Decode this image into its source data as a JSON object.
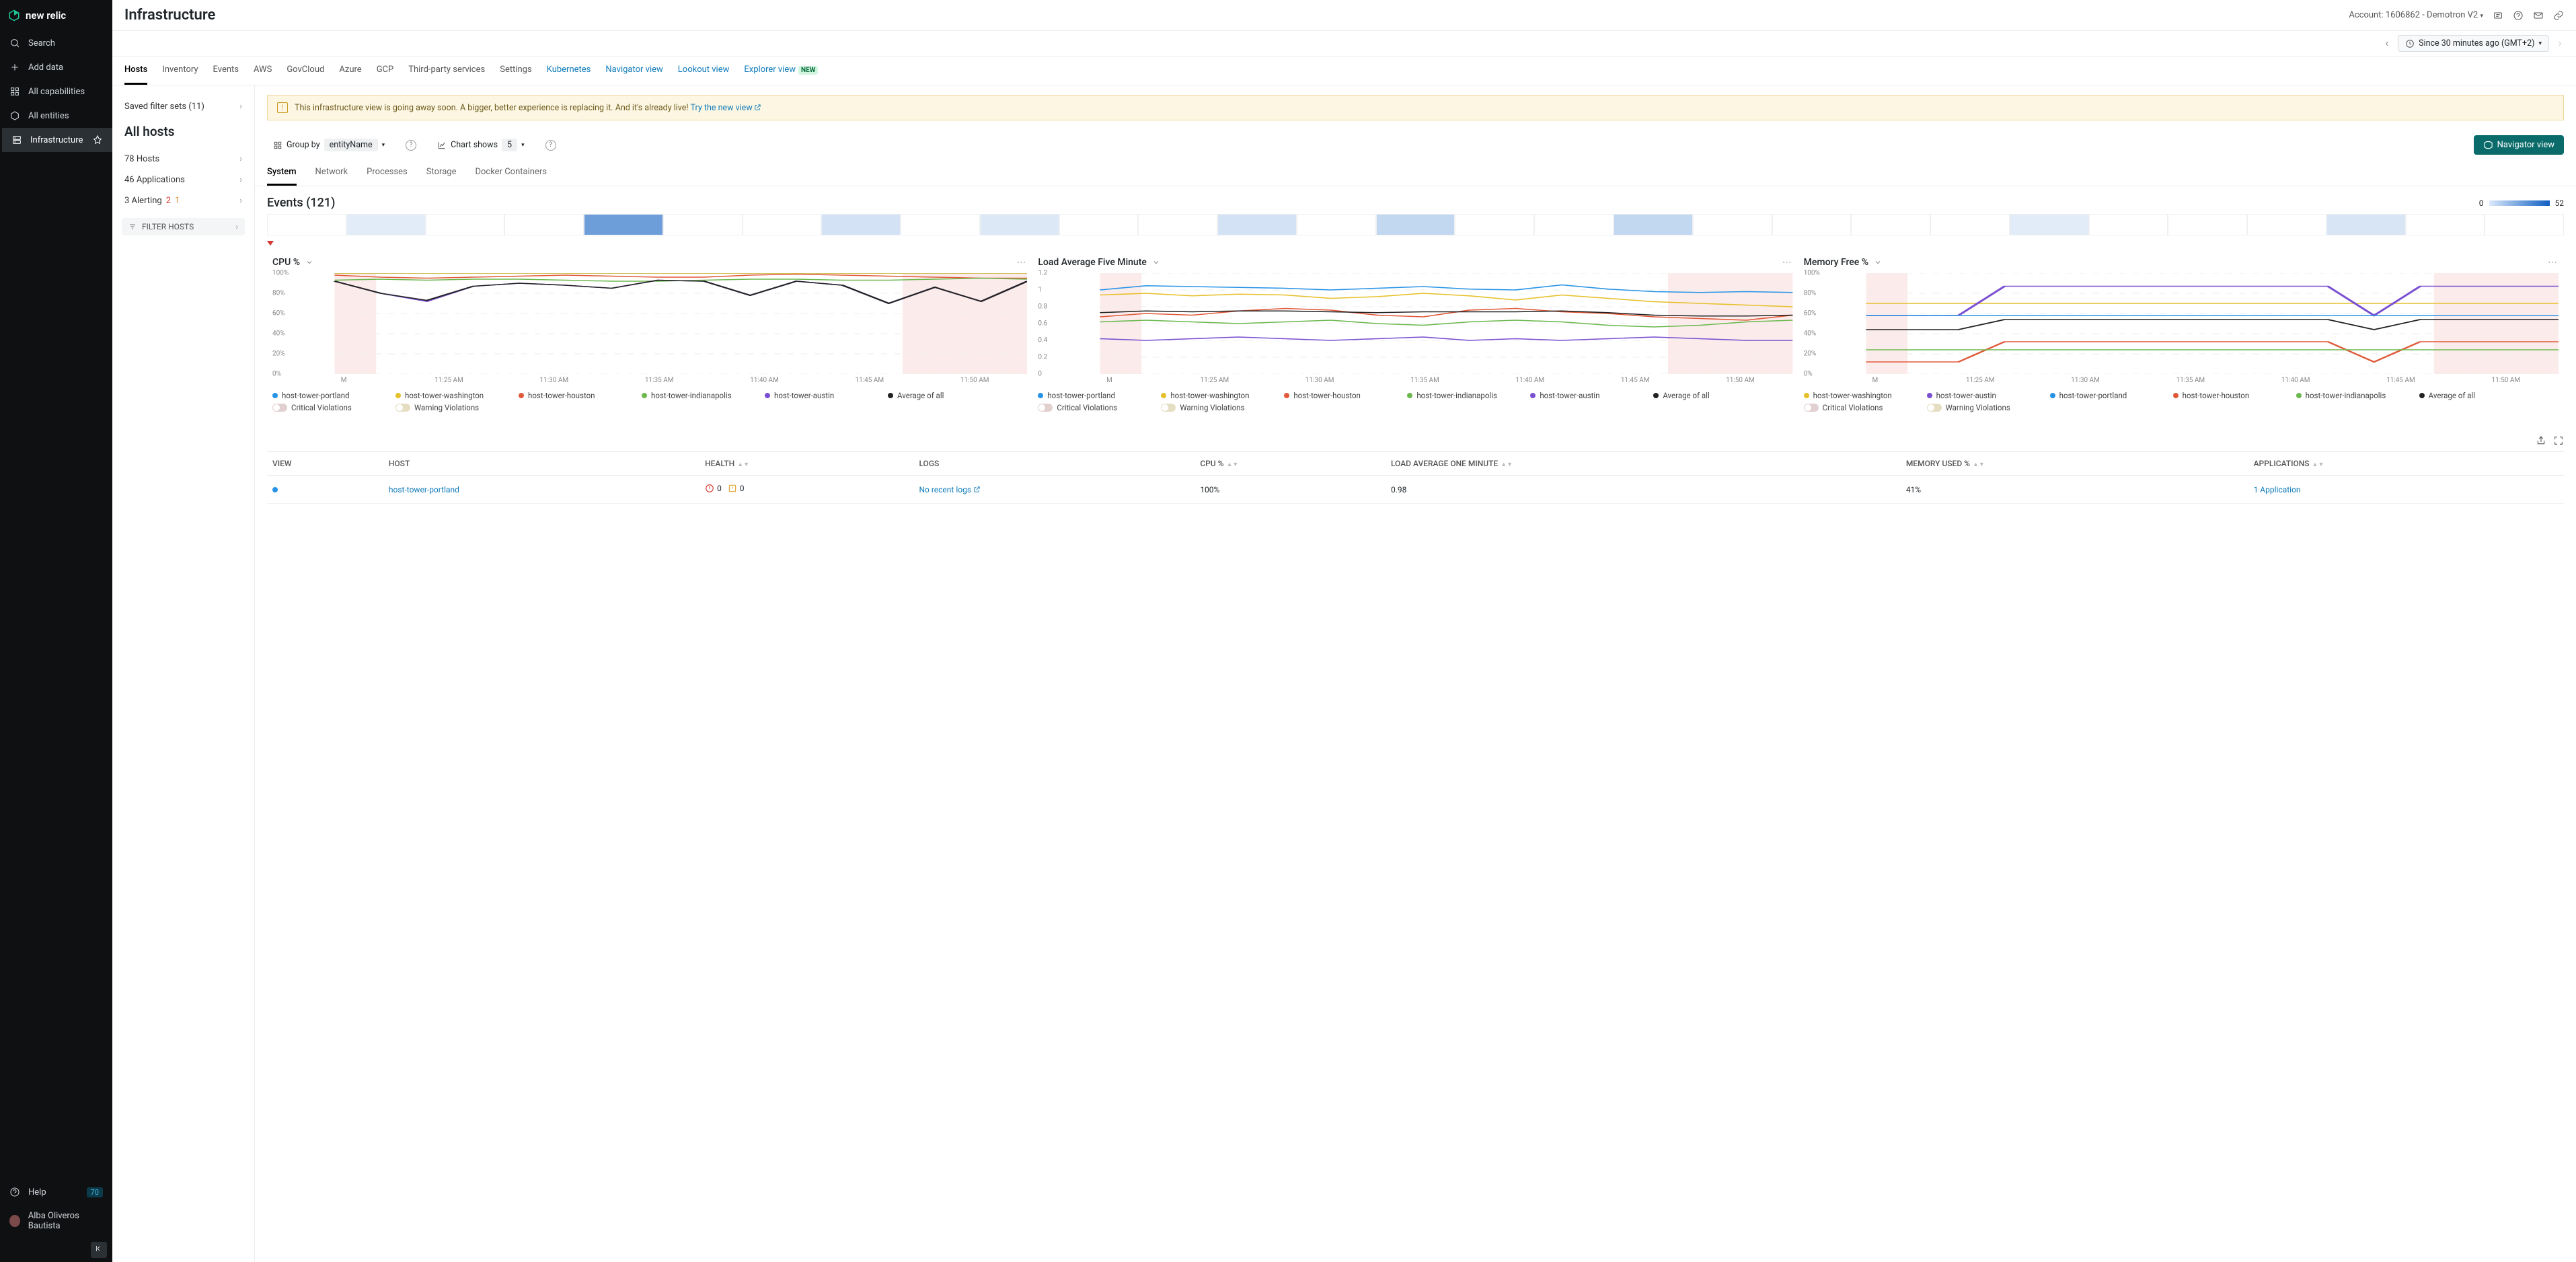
{
  "brand": "new relic",
  "page_title": "Infrastructure",
  "account_label": "Account: 1606862 - Demotron V2",
  "time_range": "Since 30 minutes ago (GMT+2)",
  "sidebar": {
    "items": [
      {
        "label": "Search",
        "icon": "search"
      },
      {
        "label": "Add data",
        "icon": "plus"
      },
      {
        "label": "All capabilities",
        "icon": "grid"
      },
      {
        "label": "All entities",
        "icon": "hex"
      },
      {
        "label": "Infrastructure",
        "icon": "server",
        "active": true
      }
    ],
    "help_label": "Help",
    "help_count": "70",
    "user_name": "Alba Oliveros Bautista"
  },
  "tabs": [
    {
      "label": "Hosts",
      "active": true
    },
    {
      "label": "Inventory"
    },
    {
      "label": "Events"
    },
    {
      "label": "AWS"
    },
    {
      "label": "GovCloud"
    },
    {
      "label": "Azure"
    },
    {
      "label": "GCP"
    },
    {
      "label": "Third-party services"
    },
    {
      "label": "Settings"
    },
    {
      "label": "Kubernetes",
      "link": true
    },
    {
      "label": "Navigator view",
      "link": true
    },
    {
      "label": "Lookout view",
      "link": true
    },
    {
      "label": "Explorer view",
      "link": true,
      "badge": "NEW"
    }
  ],
  "leftcol": {
    "saved_filters": "Saved filter sets (11)",
    "title": "All hosts",
    "rows": [
      {
        "label": "78 Hosts"
      },
      {
        "label": "46 Applications"
      },
      {
        "label": "3 Alerting",
        "red": "2",
        "orange": "1"
      }
    ],
    "filter_btn": "FILTER HOSTS"
  },
  "banner": {
    "text": "This infrastructure view is going away soon. A bigger, better experience is replacing it. And it's already live! ",
    "link": "Try the new view"
  },
  "tools": {
    "group_by_label": "Group by",
    "group_by_value": "entityName",
    "chart_shows_label": "Chart shows",
    "chart_shows_value": "5",
    "nav_view_btn": "Navigator view"
  },
  "subtabs": [
    "System",
    "Network",
    "Processes",
    "Storage",
    "Docker Containers"
  ],
  "events": {
    "title": "Events (121)",
    "scale_min": "0",
    "scale_max": "52"
  },
  "heatmap_opacity": [
    0,
    0.12,
    0,
    0,
    0.6,
    0,
    0,
    0.18,
    0,
    0.14,
    0,
    0,
    0.18,
    0,
    0.25,
    0,
    0,
    0.25,
    0,
    0,
    0,
    0,
    0.12,
    0,
    0,
    0,
    0.16,
    0,
    0
  ],
  "x_ticks": [
    "M",
    "11:25 AM",
    "11:30 AM",
    "11:35 AM",
    "11:40 AM",
    "11:45 AM",
    "11:50 AM"
  ],
  "legend_hosts": [
    {
      "name": "host-tower-portland",
      "color": "#2693e6"
    },
    {
      "name": "host-tower-washington",
      "color": "#e6c02a"
    },
    {
      "name": "host-tower-houston",
      "color": "#e05a3a"
    },
    {
      "name": "host-tower-indianapolis",
      "color": "#6cb84f"
    },
    {
      "name": "host-tower-austin",
      "color": "#7a4fd1"
    },
    {
      "name": "Average of all",
      "color": "#222"
    }
  ],
  "legend_hosts_mem": [
    {
      "name": "host-tower-washington",
      "color": "#e6c02a"
    },
    {
      "name": "host-tower-austin",
      "color": "#7a4fd1"
    },
    {
      "name": "host-tower-portland",
      "color": "#2693e6"
    },
    {
      "name": "host-tower-houston",
      "color": "#e05a3a"
    },
    {
      "name": "host-tower-indianapolis",
      "color": "#6cb84f"
    },
    {
      "name": "Average of all",
      "color": "#222"
    }
  ],
  "legend_toggles": {
    "crit": "Critical Violations",
    "warn": "Warning Violations"
  },
  "charts": {
    "cpu": {
      "title": "CPU %",
      "y_labels": [
        "100%",
        "80%",
        "60%",
        "40%",
        "20%",
        "0%"
      ]
    },
    "load": {
      "title": "Load Average Five Minute",
      "y_labels": [
        "1.2",
        "1",
        "0.8",
        "0.6",
        "0.4",
        "0.2",
        "0"
      ]
    },
    "mem": {
      "title": "Memory Free %",
      "y_labels": [
        "100%",
        "80%",
        "60%",
        "40%",
        "20%",
        "0%"
      ]
    }
  },
  "chart_data": [
    {
      "type": "line",
      "title": "CPU %",
      "ylabel": "",
      "ylim": [
        0,
        100
      ],
      "x": [
        "11:23",
        "11:25",
        "11:27",
        "11:29",
        "11:31",
        "11:33",
        "11:35",
        "11:37",
        "11:39",
        "11:41",
        "11:43",
        "11:45",
        "11:47",
        "11:49",
        "11:51",
        "11:53"
      ],
      "series": [
        {
          "name": "host-tower-portland",
          "color": "#2693e6",
          "values": [
            100,
            100,
            100,
            100,
            100,
            100,
            100,
            100,
            100,
            100,
            100,
            100,
            100,
            100,
            100,
            100
          ]
        },
        {
          "name": "host-tower-washington",
          "color": "#e6c02a",
          "values": [
            100,
            100,
            100,
            100,
            100,
            100,
            100,
            100,
            100,
            100,
            100,
            100,
            100,
            100,
            100,
            100
          ]
        },
        {
          "name": "host-tower-houston",
          "color": "#e05a3a",
          "values": [
            98,
            96,
            95,
            96,
            97,
            98,
            97,
            96,
            96,
            98,
            99,
            98,
            97,
            96,
            95,
            95
          ]
        },
        {
          "name": "host-tower-indianapolis",
          "color": "#6cb84f",
          "values": [
            93,
            94,
            93,
            94,
            94,
            93,
            92,
            92,
            93,
            94,
            94,
            93,
            93,
            94,
            95,
            94
          ]
        },
        {
          "name": "host-tower-austin",
          "color": "#7a4fd1",
          "values": [
            92,
            80,
            72,
            87,
            90,
            88,
            85,
            93,
            92,
            78,
            92,
            88,
            70,
            86,
            72,
            92
          ]
        },
        {
          "name": "Average of all",
          "color": "#222",
          "values": [
            92,
            80,
            73,
            87,
            90,
            88,
            85,
            93,
            92,
            78,
            92,
            88,
            70,
            86,
            72,
            92
          ]
        }
      ],
      "violation_bands": [
        [
          0,
          0.06
        ],
        [
          0.82,
          1.0
        ]
      ]
    },
    {
      "type": "line",
      "title": "Load Average Five Minute",
      "ylabel": "",
      "ylim": [
        0,
        1.2
      ],
      "x": [
        "11:23",
        "11:25",
        "11:27",
        "11:29",
        "11:31",
        "11:33",
        "11:35",
        "11:37",
        "11:39",
        "11:41",
        "11:43",
        "11:45",
        "11:47",
        "11:49",
        "11:51",
        "11:53"
      ],
      "series": [
        {
          "name": "host-tower-portland",
          "color": "#2693e6",
          "values": [
            1.0,
            1.05,
            1.04,
            1.03,
            1.02,
            1.0,
            1.02,
            1.04,
            1.01,
            1.0,
            1.06,
            1.01,
            0.98,
            0.97,
            0.98,
            0.97
          ]
        },
        {
          "name": "host-tower-washington",
          "color": "#e6c02a",
          "values": [
            0.94,
            0.96,
            0.93,
            0.95,
            0.94,
            0.9,
            0.92,
            0.96,
            0.93,
            0.88,
            0.94,
            0.9,
            0.86,
            0.84,
            0.82,
            0.8
          ]
        },
        {
          "name": "host-tower-houston",
          "color": "#e05a3a",
          "values": [
            0.68,
            0.72,
            0.7,
            0.75,
            0.78,
            0.76,
            0.7,
            0.68,
            0.76,
            0.78,
            0.74,
            0.72,
            0.68,
            0.66,
            0.64,
            0.7
          ]
        },
        {
          "name": "host-tower-indianapolis",
          "color": "#6cb84f",
          "values": [
            0.62,
            0.64,
            0.62,
            0.6,
            0.62,
            0.64,
            0.6,
            0.58,
            0.62,
            0.64,
            0.62,
            0.58,
            0.56,
            0.58,
            0.62,
            0.64
          ]
        },
        {
          "name": "host-tower-austin",
          "color": "#7a4fd1",
          "values": [
            0.42,
            0.4,
            0.42,
            0.44,
            0.42,
            0.4,
            0.42,
            0.44,
            0.4,
            0.42,
            0.4,
            0.42,
            0.44,
            0.42,
            0.4,
            0.4
          ]
        },
        {
          "name": "Average of all",
          "color": "#222",
          "values": [
            0.73,
            0.75,
            0.74,
            0.75,
            0.75,
            0.74,
            0.73,
            0.74,
            0.74,
            0.74,
            0.75,
            0.73,
            0.7,
            0.69,
            0.69,
            0.7
          ]
        }
      ],
      "violation_bands": [
        [
          0,
          0.06
        ],
        [
          0.82,
          1.0
        ]
      ]
    },
    {
      "type": "line",
      "title": "Memory Free %",
      "ylabel": "",
      "ylim": [
        0,
        100
      ],
      "x": [
        "11:23",
        "11:25",
        "11:27",
        "11:29",
        "11:31",
        "11:33",
        "11:35",
        "11:37",
        "11:39",
        "11:41",
        "11:43",
        "11:45",
        "11:47",
        "11:49",
        "11:51",
        "11:53"
      ],
      "series": [
        {
          "name": "host-tower-washington",
          "color": "#e6c02a",
          "values": [
            70,
            70,
            70,
            70,
            70,
            70,
            70,
            70,
            70,
            70,
            70,
            70,
            70,
            70,
            70,
            70
          ]
        },
        {
          "name": "host-tower-austin",
          "color": "#7a4fd1",
          "values": [
            58,
            58,
            58,
            87,
            87,
            87,
            87,
            87,
            87,
            87,
            87,
            58,
            87,
            87,
            87,
            87
          ]
        },
        {
          "name": "host-tower-portland",
          "color": "#2693e6",
          "values": [
            58,
            58,
            58,
            58,
            58,
            58,
            58,
            58,
            58,
            58,
            58,
            58,
            58,
            58,
            58,
            58
          ]
        },
        {
          "name": "host-tower-houston",
          "color": "#e05a3a",
          "values": [
            12,
            12,
            12,
            32,
            32,
            32,
            32,
            32,
            32,
            32,
            32,
            12,
            32,
            32,
            32,
            32
          ]
        },
        {
          "name": "host-tower-indianapolis",
          "color": "#6cb84f",
          "values": [
            24,
            24,
            24,
            24,
            24,
            24,
            24,
            24,
            24,
            24,
            24,
            24,
            24,
            24,
            24,
            24
          ]
        },
        {
          "name": "Average of all",
          "color": "#222",
          "values": [
            44,
            44,
            44,
            54,
            54,
            54,
            54,
            54,
            54,
            54,
            54,
            44,
            54,
            54,
            54,
            54
          ]
        }
      ],
      "violation_bands": [
        [
          0,
          0.06
        ],
        [
          0.82,
          1.0
        ]
      ]
    }
  ],
  "table": {
    "columns": [
      "VIEW",
      "HOST",
      "HEALTH",
      "LOGS",
      "CPU %",
      "LOAD AVERAGE ONE MINUTE",
      "MEMORY USED %",
      "APPLICATIONS"
    ],
    "rows": [
      {
        "host": "host-tower-portland",
        "health_crit": "0",
        "health_warn": "0",
        "logs": "No recent logs",
        "cpu": "100%",
        "load": "0.98",
        "mem": "41%",
        "apps": "1 Application"
      }
    ]
  }
}
